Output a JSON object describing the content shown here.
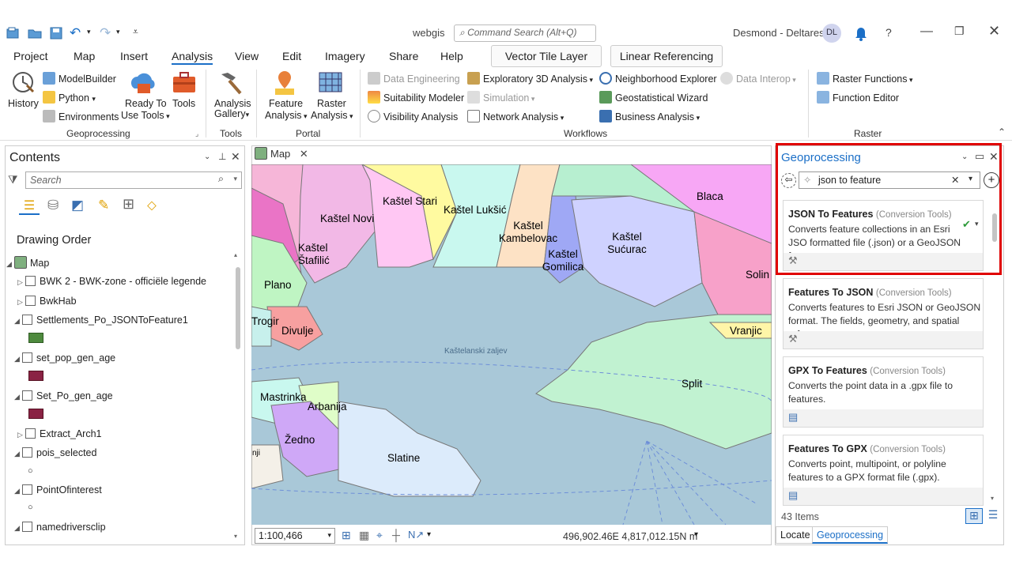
{
  "window": {
    "app_name": "webgis",
    "user": "Desmond - Deltares",
    "initials": "DL",
    "command_search_placeholder": "Command Search (Alt+Q)",
    "help": "?"
  },
  "menu": {
    "tabs": [
      "Project",
      "Map",
      "Insert",
      "Analysis",
      "View",
      "Edit",
      "Imagery",
      "Share",
      "Help"
    ],
    "active": "Analysis",
    "contextual": [
      "Vector Tile Layer",
      "Linear Referencing"
    ]
  },
  "ribbon": {
    "history": "History",
    "modelbuilder": "ModelBuilder",
    "python": "Python",
    "environments": "Environments",
    "ready_to_use_1": "Ready To",
    "ready_to_use_2": "Use Tools",
    "tools": "Tools",
    "analysis_gallery_1": "Analysis",
    "analysis_gallery_2": "Gallery",
    "feature_analysis_1": "Feature",
    "feature_analysis_2": "Analysis",
    "raster_analysis_1": "Raster",
    "raster_analysis_2": "Analysis",
    "data_engineering": "Data Engineering",
    "suitability_modeler": "Suitability Modeler",
    "visibility_analysis": "Visibility Analysis",
    "exploratory_3d": "Exploratory 3D Analysis",
    "simulation": "Simulation",
    "network_analysis": "Network Analysis",
    "neighborhood_explorer": "Neighborhood Explorer",
    "data_interop": "Data Interop",
    "geostatistical_wizard": "Geostatistical Wizard",
    "business_analysis": "Business Analysis",
    "raster_functions": "Raster Functions",
    "function_editor": "Function Editor",
    "groups": {
      "geoprocessing": "Geoprocessing",
      "tools": "Tools",
      "portal": "Portal",
      "workflows": "Workflows",
      "raster": "Raster"
    }
  },
  "contents": {
    "title": "Contents",
    "search_placeholder": "Search",
    "drawing_order": "Drawing Order",
    "map": "Map",
    "layers": [
      {
        "name": "BWK 2 - BWK-zone - officiële legende"
      },
      {
        "name": "BwkHab"
      },
      {
        "name": "Settlements_Po_JSONToFeature1",
        "swatch": "#4e8a3e"
      },
      {
        "name": "set_pop_gen_age",
        "swatch": "#8a2244"
      },
      {
        "name": "Set_Po_gen_age",
        "swatch": "#8a2244"
      },
      {
        "name": "Extract_Arch1"
      },
      {
        "name": "pois_selected"
      },
      {
        "name": "PointOfinterest"
      },
      {
        "name": "namedriversclip"
      }
    ]
  },
  "map": {
    "tab": "Map",
    "labels": [
      "Kaštel Stari",
      "Kaštel Lukšić",
      "Kaštel Novi",
      "Blaca",
      "Kaštel Štafilić",
      "Kaštel Kambelovac",
      "Kaštel Sućurac",
      "Kaštel Gomilica",
      "Solin",
      "Plano",
      "Trogir",
      "Divulje",
      "Vranjic",
      "Kaštelanski zaljev",
      "Split",
      "Mastrinka",
      "Arbanija",
      "Žedno",
      "Slatine",
      "nji"
    ],
    "scale": "1:100,466",
    "coordinates": "496,902.46E 4,817,012.15N m"
  },
  "geoprocessing": {
    "title": "Geoprocessing",
    "search_value": "json to feature",
    "results": [
      {
        "name": "JSON To Features",
        "toolbox": "(Conversion Tools)",
        "desc": "Converts feature collections in an Esri JSO formatted file (.json) or a GeoJSON form.."
      },
      {
        "name": "Features To JSON",
        "toolbox": "(Conversion Tools)",
        "desc": "Converts features to Esri JSON or GeoJSON format. The fields, geometry, and spatial ref..."
      },
      {
        "name": "GPX To Features",
        "toolbox": "(Conversion Tools)",
        "desc": "Converts the point data in a .gpx file to features."
      },
      {
        "name": "Features To GPX",
        "toolbox": "(Conversion Tools)",
        "desc": "Converts point, multipoint, or polyline features to a GPX format file (.gpx)."
      }
    ],
    "count": "43 Items",
    "bottom_tabs": [
      "Locate",
      "Geoprocessing"
    ]
  },
  "colors": {
    "accent": "#1b6fc7",
    "highlight": "#e00000",
    "sea": "#a9c8d8"
  }
}
